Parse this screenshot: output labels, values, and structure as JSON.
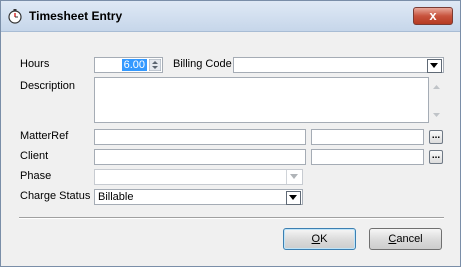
{
  "window": {
    "title": "Timesheet Entry",
    "close_glyph": "x"
  },
  "form": {
    "hours_label": "Hours",
    "hours_value": "6.00",
    "billing_code_label": "Billing Code",
    "billing_code_value": "",
    "description_label": "Description",
    "description_value": "",
    "matterref_label": "MatterRef",
    "matterref_value_1": "",
    "matterref_value_2": "",
    "client_label": "Client",
    "client_value_1": "",
    "client_value_2": "",
    "phase_label": "Phase",
    "phase_value": "",
    "charge_status_label": "Charge Status",
    "charge_status_value": "Billable",
    "ellipsis": "..."
  },
  "buttons": {
    "ok_mnemonic": "O",
    "ok_rest": "K",
    "cancel_mnemonic": "C",
    "cancel_rest": "ancel"
  }
}
